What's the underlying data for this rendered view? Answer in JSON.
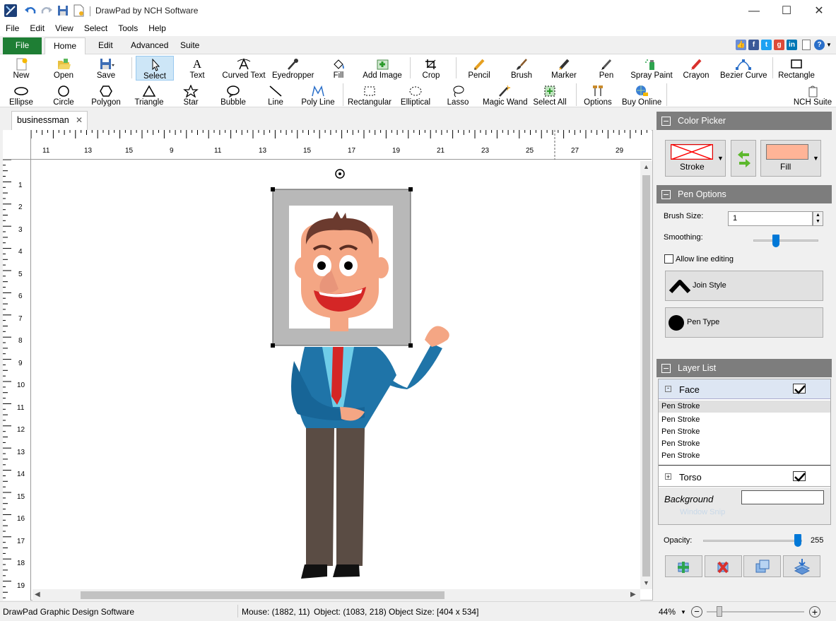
{
  "window": {
    "title": "DrawPad by NCH Software",
    "minimize": "—",
    "maximize": "☐",
    "close": "✕"
  },
  "menu": [
    "File",
    "Edit",
    "View",
    "Select",
    "Tools",
    "Help"
  ],
  "ribbon_tabs": {
    "file": "File",
    "home": "Home",
    "edit": "Edit",
    "advanced": "Advanced",
    "suite": "Suite"
  },
  "tools_row1": [
    "New",
    "Open",
    "Save",
    "Select",
    "Text",
    "Curved Text",
    "Eyedropper",
    "Fill",
    "Add Image",
    "Crop",
    "Pencil",
    "Brush",
    "Marker",
    "Pen",
    "Spray Paint",
    "Crayon",
    "Bezier Curve",
    "Rectangle"
  ],
  "tools_row2": [
    "Ellipse",
    "Circle",
    "Polygon",
    "Triangle",
    "Star",
    "Bubble",
    "Line",
    "Poly Line",
    "Rectangular",
    "Elliptical",
    "Lasso",
    "Magic Wand",
    "Select All",
    "Options",
    "Buy Online",
    "NCH Suite"
  ],
  "document": {
    "tab": "businessman",
    "close": "✕"
  },
  "ruler": {
    "h_labels": [
      "11",
      "13",
      "15",
      "9",
      "11",
      "13",
      "15",
      "17",
      "19",
      "21",
      "23",
      "25",
      "27",
      "29"
    ],
    "v_labels": [
      "1",
      "2",
      "3",
      "4",
      "5",
      "6",
      "7",
      "8",
      "9",
      "10",
      "11",
      "12",
      "13",
      "14",
      "15",
      "16",
      "17",
      "18",
      "19"
    ]
  },
  "color_picker": {
    "title": "Color Picker",
    "stroke": "Stroke",
    "fill": "Fill",
    "fill_color": "#ffb497",
    "stroke_color": "#ff0000"
  },
  "pen_options": {
    "title": "Pen Options",
    "brush_size_label": "Brush Size:",
    "brush_size": "1",
    "smoothing_label": "Smoothing:",
    "allow_line_editing": "Allow line editing",
    "join_style": "Join Style",
    "pen_type": "Pen Type"
  },
  "layer_list": {
    "title": "Layer List",
    "face": "Face",
    "face_items": [
      "Pen Stroke",
      "Pen Stroke",
      "Pen Stroke",
      "Pen Stroke",
      "Pen Stroke"
    ],
    "torso": "Torso",
    "background": "Background",
    "ghost": "Window Snip"
  },
  "opacity": {
    "label": "Opacity:",
    "value": "255"
  },
  "status": {
    "app": "DrawPad Graphic Design Software",
    "mouse": "Mouse: (1882, 11)",
    "object": "Object: (1083, 218)",
    "object_size": "Object Size: [404 x 534]",
    "zoom": "44%"
  },
  "colors": {
    "file_tab": "#1e7e34",
    "panel_header": "#7d7d7d",
    "select_highlight": "#cde6f7"
  }
}
